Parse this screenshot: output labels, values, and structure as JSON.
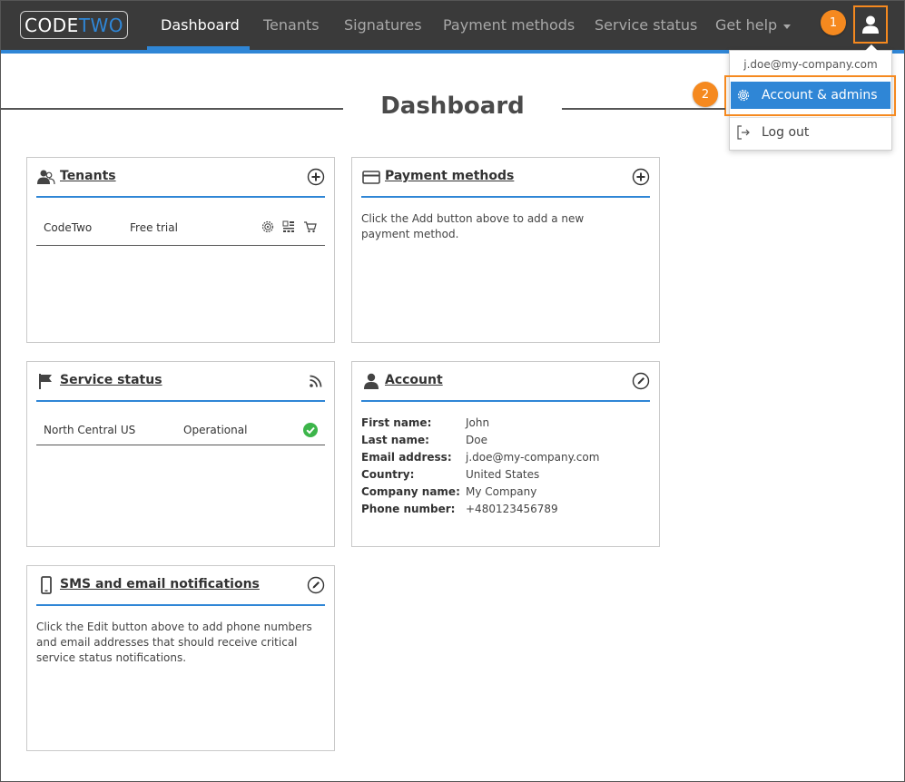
{
  "brand": {
    "logo_code": "CODE",
    "logo_two": "TWO"
  },
  "nav": {
    "items": [
      "Dashboard",
      "Tenants",
      "Signatures",
      "Payment methods",
      "Service status",
      "Get help"
    ]
  },
  "badges": {
    "one": "1",
    "two": "2"
  },
  "user_menu": {
    "email": "j.doe@my-company.com",
    "account_admins": "Account & admins",
    "logout": "Log out"
  },
  "page": {
    "title": "Dashboard"
  },
  "tenants": {
    "title": "Tenants",
    "rows": [
      {
        "name": "CodeTwo",
        "plan": "Free trial"
      }
    ]
  },
  "payment": {
    "title": "Payment methods",
    "text": "Click the Add button above to add a new payment method."
  },
  "service": {
    "title": "Service status",
    "rows": [
      {
        "region": "North Central US",
        "status": "Operational"
      }
    ]
  },
  "account": {
    "title": "Account",
    "fields": [
      {
        "label": "First name:",
        "value": "John"
      },
      {
        "label": "Last name:",
        "value": "Doe"
      },
      {
        "label": "Email address:",
        "value": "j.doe@my-company.com"
      },
      {
        "label": "Country:",
        "value": "United States"
      },
      {
        "label": "Company name:",
        "value": "My Company"
      },
      {
        "label": "Phone number:",
        "value": "+480123456789"
      }
    ]
  },
  "sms": {
    "title": "SMS and email notifications",
    "text": "Click the Edit button above to add phone numbers and email addresses that should receive critical service status notifications."
  },
  "colors": {
    "accent": "#2f86d6",
    "highlight": "#f5891f",
    "navbar": "#3a3a3a",
    "ok": "#3cb54a"
  }
}
